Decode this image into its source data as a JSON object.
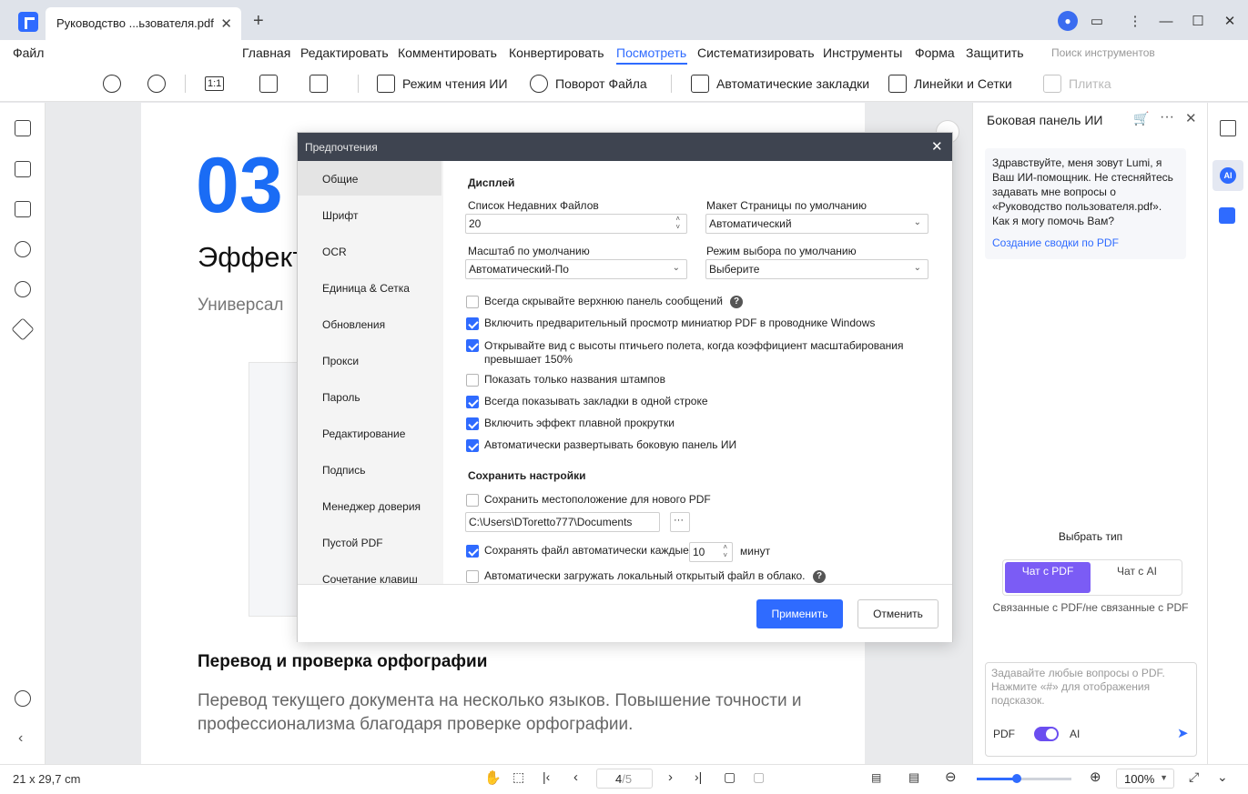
{
  "window": {
    "tab_title": "Руководство ...ьзователя.pdf",
    "tab_close": "✕",
    "tab_add": "+"
  },
  "menu": {
    "file": "Файл",
    "items": [
      "Главная",
      "Редактировать",
      "Комментировать",
      "Конвертировать",
      "Посмотреть",
      "Систематизировать",
      "Инструменты",
      "Форма",
      "Защитить"
    ],
    "active": "Посмотреть",
    "search_placeholder": "Поиск инструментов"
  },
  "toolbar": {
    "ratio": "1:1",
    "reading_mode": "Режим чтения ИИ",
    "rotate": "Поворот Файла",
    "auto_bookmarks": "Автоматические закладки",
    "rulers_grids": "Линейки и Сетки",
    "tile": "Плитка"
  },
  "document": {
    "number": "03",
    "heading": "Эффект",
    "subheading": "Универсал",
    "section_title": "Перевод и проверка орфографии",
    "paragraph": "Перевод текущего документа на несколько языков. Повышение точности и профессионализма благодаря проверке орфографии."
  },
  "dialog": {
    "title": "Предпочтения",
    "nav": [
      "Общие",
      "Шрифт",
      "OCR",
      "Единица & Сетка",
      "Обновления",
      "Прокси",
      "Пароль",
      "Редактирование",
      "Подпись",
      "Менеджер доверия",
      "Пустой PDF",
      "Сочетание клавиш"
    ],
    "selected_nav": "Общие",
    "display_section": "Дисплей",
    "recent_files_label": "Список Недавних Файлов",
    "recent_files_value": "20",
    "page_layout_label": "Макет Страницы по умолчанию",
    "page_layout_value": "Автоматический",
    "zoom_label": "Масштаб по умолчанию",
    "zoom_value": "Автоматический-По",
    "select_mode_label": "Режим выбора по умолчанию",
    "select_mode_value": "Выберите",
    "checkboxes": [
      {
        "label": "Всегда скрывайте верхнюю панель сообщений",
        "checked": false
      },
      {
        "label": "Включить предварительный просмотр миниатюр PDF в проводнике Windows",
        "checked": true
      },
      {
        "label": "Открывайте вид с высоты птичьего полета, когда коэффициент масштабирования превышает 150%",
        "checked": true
      },
      {
        "label": "Показать только названия штампов",
        "checked": false
      },
      {
        "label": "Всегда показывать закладки в одной строке",
        "checked": true
      },
      {
        "label": "Включить эффект плавной прокрутки",
        "checked": true
      },
      {
        "label": "Автоматически развертывать боковую панель ИИ",
        "checked": true
      }
    ],
    "save_section": "Сохранить настройки",
    "save_location_label": "Сохранить местоположение для нового PDF",
    "save_location_checked": false,
    "save_path": "C:\\Users\\DToretto777\\Documents",
    "browse": "···",
    "autosave_label": "Сохранять файл автоматически каждые",
    "autosave_checked": true,
    "autosave_value": "10",
    "autosave_unit": "минут",
    "cloud_label": "Автоматически загружать локальный открытый файл в облако.",
    "cloud_checked": false,
    "apply": "Применить",
    "cancel": "Отменить"
  },
  "ai_panel": {
    "title": "Боковая панель ИИ",
    "greeting": "Здравствуйте, меня зовут Lumi, я Ваш ИИ-помощник. Не стесняйтесь задавать мне вопросы о «Руководство пользователя.pdf». Как я могу помочь Вам?",
    "summary_link": "Создание сводки по PDF",
    "choose_type": "Выбрать тип",
    "chat_pdf": "Чат с PDF",
    "chat_ai": "Чат с AI",
    "segment_caption": "Связанные с PDF/не связанные с PDF",
    "input_placeholder": "Задавайте любые вопросы о PDF. Нажмите «#» для отображения подсказок.",
    "toggle_pdf": "PDF",
    "toggle_ai": "AI",
    "rail_ai": "AI"
  },
  "status": {
    "page_size": "21 x 29,7 cm",
    "page_current": "4",
    "page_total": "/5",
    "zoom": "100%",
    "zoom_fraction": 0.42
  },
  "colors": {
    "accent": "#2f6bff",
    "ai_purple": "#7b5cf5",
    "title_bar": "#dfe3ea",
    "dialog_header": "#3e4450"
  }
}
